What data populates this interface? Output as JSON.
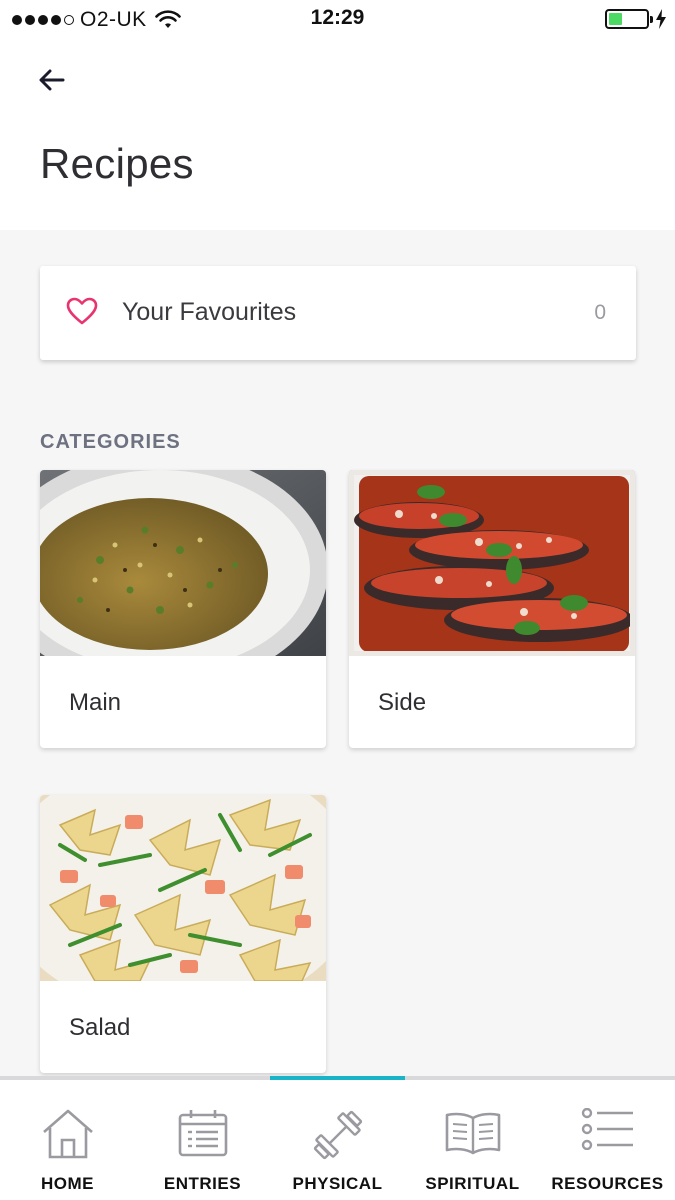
{
  "status_bar": {
    "carrier": "O2-UK",
    "time": "12:29",
    "battery_level": 0.35,
    "signal_bars": 4
  },
  "header": {
    "title": "Recipes",
    "back_icon": "arrow-left-icon"
  },
  "favourites": {
    "label": "Your Favourites",
    "count": "0",
    "icon": "heart-icon",
    "icon_color": "#e8346f"
  },
  "categories": {
    "title": "CATEGORIES",
    "items": [
      {
        "label": "Main",
        "image": "fried-rice-bowl"
      },
      {
        "label": "Side",
        "image": "baked-eggplant-dish"
      },
      {
        "label": "Salad",
        "image": "farfalle-salmon-salad"
      }
    ]
  },
  "tabs": {
    "active_index": 2,
    "accent_color": "#1ab4c8",
    "items": [
      {
        "label": "HOME",
        "icon": "house-icon"
      },
      {
        "label": "ENTRIES",
        "icon": "calendar-icon"
      },
      {
        "label": "PHYSICAL",
        "icon": "dumbbell-icon"
      },
      {
        "label": "SPIRITUAL",
        "icon": "open-book-icon"
      },
      {
        "label": "RESOURCES",
        "icon": "list-icon"
      }
    ]
  }
}
